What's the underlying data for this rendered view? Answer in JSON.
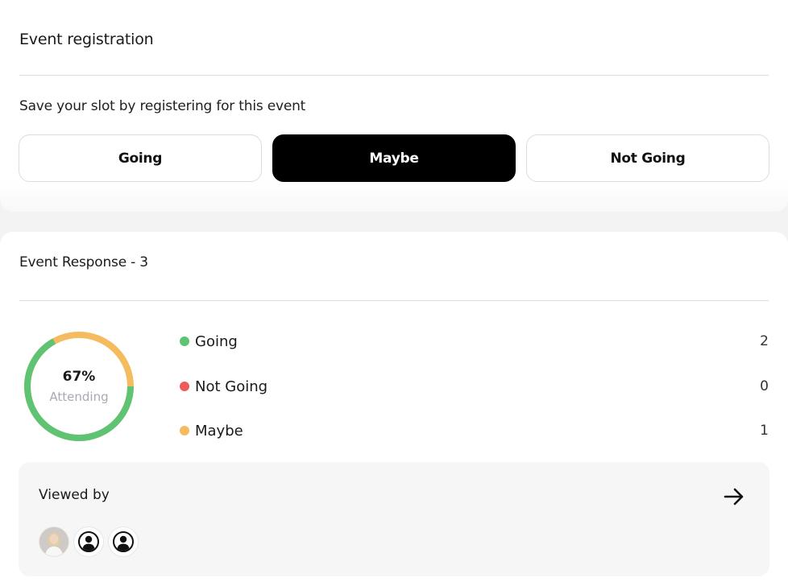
{
  "registration": {
    "title": "Event registration",
    "subtitle": "Save your slot by registering for this event",
    "options": [
      "Going",
      "Maybe",
      "Not Going"
    ],
    "selected": "Maybe"
  },
  "response": {
    "title": "Event Response - 3",
    "donut": {
      "percent_text": "67%",
      "label": "Attending",
      "going_fraction": 0.67
    },
    "legend": [
      {
        "label": "Going",
        "count": "2",
        "color": "#5fc374"
      },
      {
        "label": "Not Going",
        "count": "0",
        "color": "#ef5b57"
      },
      {
        "label": "Maybe",
        "count": "1",
        "color": "#f5bb5f"
      }
    ]
  },
  "viewed": {
    "title": "Viewed by",
    "arrow_icon": "arrow-right-icon",
    "avatars": [
      "user-photo-avatar",
      "default-user-icon",
      "default-user-icon"
    ]
  }
}
